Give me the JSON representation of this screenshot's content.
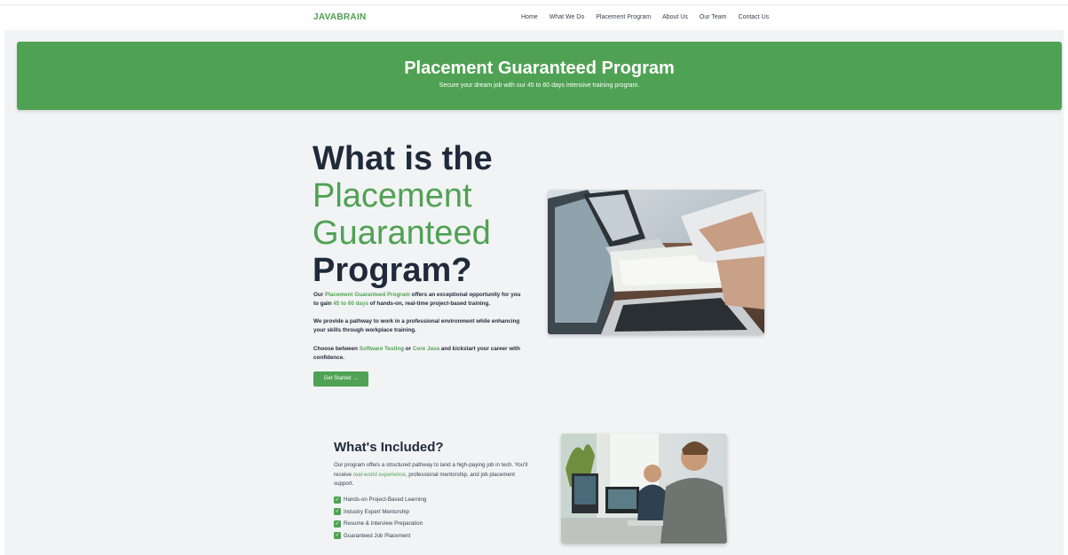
{
  "nav": {
    "logo": "JAVABRAIN",
    "links": [
      "Home",
      "What We Do",
      "Placement Program",
      "About Us",
      "Our Team",
      "Contact Us"
    ]
  },
  "hero": {
    "title": "Placement Guaranteed Program",
    "subtitle": "Secure your dream job with our 45 to 60 days intensive training program."
  },
  "intro": {
    "title_line1": "What is the",
    "title_line2": "Placement",
    "title_line3": "Guaranteed",
    "title_line4": "Program?",
    "p1_a": "Our ",
    "p1_b": "Placement Guaranteed Program",
    "p1_c": " offers an exceptional opportunity for you to gain ",
    "p1_d": "45 to 60 days",
    "p1_e": " of hands-on, real-time project-based training.",
    "p2": "We provide a pathway to work in a professional environment while enhancing your skills through workplace training.",
    "p3_a": "Choose between ",
    "p3_b": "Software Testing",
    "p3_c": " or ",
    "p3_d": "Core Java",
    "p3_e": " and kickstart your career with confidence.",
    "cta": "Get Started →"
  },
  "included": {
    "title": "What's Included?",
    "text_a": "Our program offers a structured pathway to land a high-paying job in tech. You'll receive ",
    "text_b": "real-world experience",
    "text_c": ", professional mentorship, and job placement support.",
    "items": [
      "Hands-on Project-Based Learning",
      "Industry Expert Mentorship",
      "Resume & Interview Preparation",
      "Guaranteed Job Placement"
    ]
  },
  "colors": {
    "accent": "#4fa253",
    "heading": "#1f2a3a",
    "page_bg": "#f2f3f5"
  },
  "icons": {
    "check": "check-icon"
  }
}
